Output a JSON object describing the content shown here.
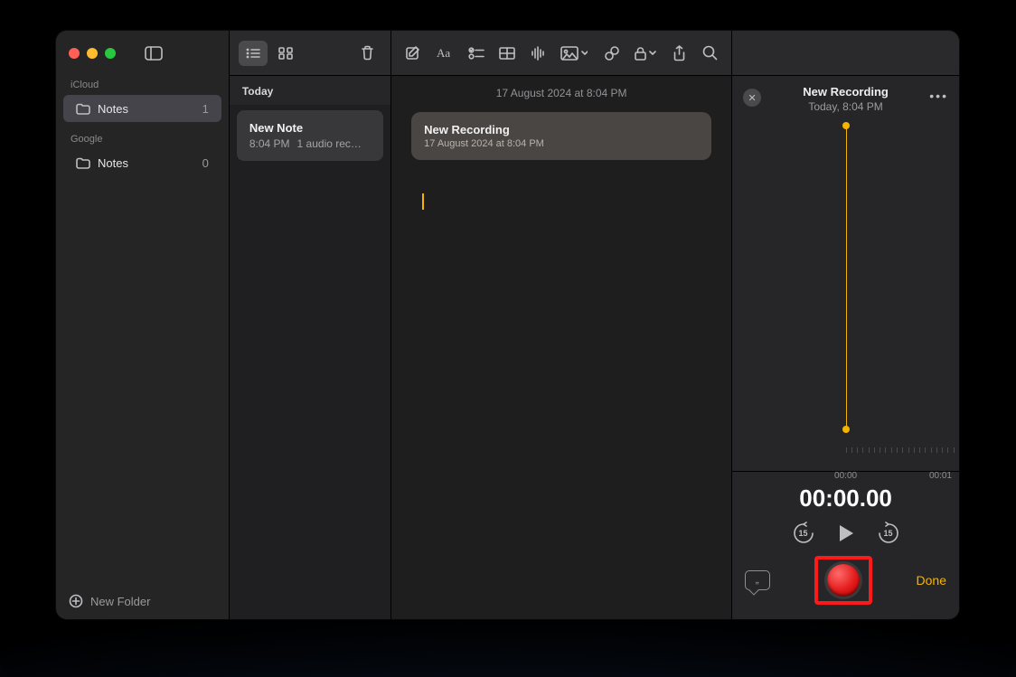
{
  "sidebar": {
    "sections": [
      {
        "label": "iCloud",
        "folder": "Notes",
        "count": "1",
        "selected": true
      },
      {
        "label": "Google",
        "folder": "Notes",
        "count": "0",
        "selected": false
      }
    ],
    "new_folder_label": "New Folder"
  },
  "notes_list": {
    "section_header": "Today",
    "items": [
      {
        "title": "New Note",
        "time": "8:04 PM",
        "preview": "1 audio rec…"
      }
    ]
  },
  "editor": {
    "date_line": "17 August 2024 at 8:04 PM",
    "recording_chip": {
      "title": "New Recording",
      "subtitle": "17 August 2024 at 8:04 PM"
    }
  },
  "recording_panel": {
    "title": "New Recording",
    "subtitle": "Today, 8:04 PM",
    "ruler": {
      "start": "00:00",
      "next": "00:01"
    },
    "timecode": "00:00.00",
    "skip_seconds": "15",
    "done_label": "Done"
  },
  "icons": {
    "close_glyph": "✕",
    "more_glyph": "•••",
    "quote_glyph": "„"
  }
}
